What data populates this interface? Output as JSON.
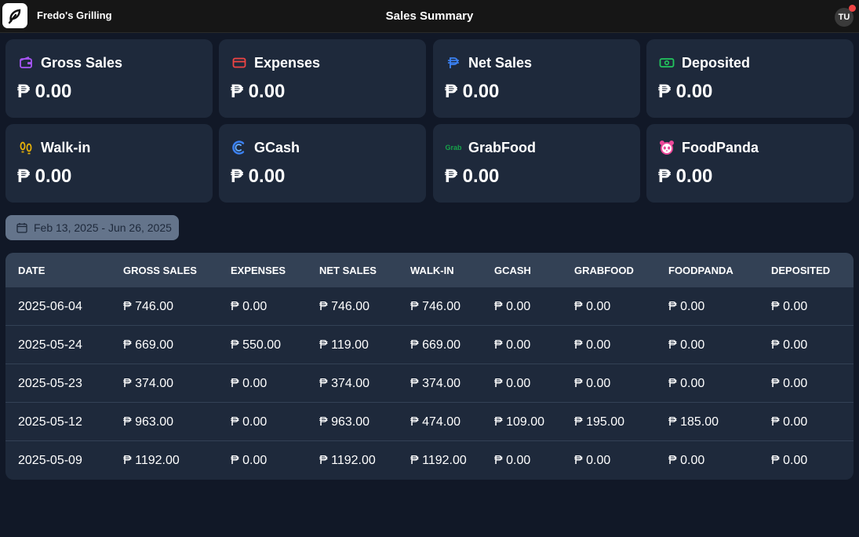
{
  "header": {
    "brand": "Fredo's Grilling",
    "title": "Sales Summary",
    "avatar_initials": "TU"
  },
  "cards": [
    {
      "label": "Gross Sales",
      "value": "₱ 0.00",
      "icon": "wallet-icon",
      "color": "#a855f7"
    },
    {
      "label": "Expenses",
      "value": "₱ 0.00",
      "icon": "credit-card-icon",
      "color": "#ef4444"
    },
    {
      "label": "Net Sales",
      "value": "₱ 0.00",
      "icon": "peso-icon",
      "color": "#3b82f6"
    },
    {
      "label": "Deposited",
      "value": "₱ 0.00",
      "icon": "banknote-icon",
      "color": "#22c55e"
    },
    {
      "label": "Walk-in",
      "value": "₱ 0.00",
      "icon": "footprints-icon",
      "color": "#eab308"
    },
    {
      "label": "GCash",
      "value": "₱ 0.00",
      "icon": "gcash-icon",
      "color": "#3b82f6"
    },
    {
      "label": "GrabFood",
      "value": "₱ 0.00",
      "icon": "grab-icon",
      "color": "#16a34a",
      "icon_text": "Grab"
    },
    {
      "label": "FoodPanda",
      "value": "₱ 0.00",
      "icon": "panda-icon",
      "color": "#ec4899"
    }
  ],
  "date_range": "Feb 13, 2025 - Jun 26, 2025",
  "table": {
    "columns": [
      "DATE",
      "GROSS SALES",
      "EXPENSES",
      "NET SALES",
      "WALK-IN",
      "GCASH",
      "GRABFOOD",
      "FOODPANDA",
      "DEPOSITED"
    ],
    "rows": [
      [
        "2025-06-04",
        "₱ 746.00",
        "₱ 0.00",
        "₱ 746.00",
        "₱ 746.00",
        "₱ 0.00",
        "₱ 0.00",
        "₱ 0.00",
        "₱ 0.00"
      ],
      [
        "2025-05-24",
        "₱ 669.00",
        "₱ 550.00",
        "₱ 119.00",
        "₱ 669.00",
        "₱ 0.00",
        "₱ 0.00",
        "₱ 0.00",
        "₱ 0.00"
      ],
      [
        "2025-05-23",
        "₱ 374.00",
        "₱ 0.00",
        "₱ 374.00",
        "₱ 374.00",
        "₱ 0.00",
        "₱ 0.00",
        "₱ 0.00",
        "₱ 0.00"
      ],
      [
        "2025-05-12",
        "₱ 963.00",
        "₱ 0.00",
        "₱ 963.00",
        "₱ 474.00",
        "₱ 109.00",
        "₱ 195.00",
        "₱ 185.00",
        "₱ 0.00"
      ],
      [
        "2025-05-09",
        "₱ 1192.00",
        "₱ 0.00",
        "₱ 1192.00",
        "₱ 1192.00",
        "₱ 0.00",
        "₱ 0.00",
        "₱ 0.00",
        "₱ 0.00"
      ]
    ]
  }
}
